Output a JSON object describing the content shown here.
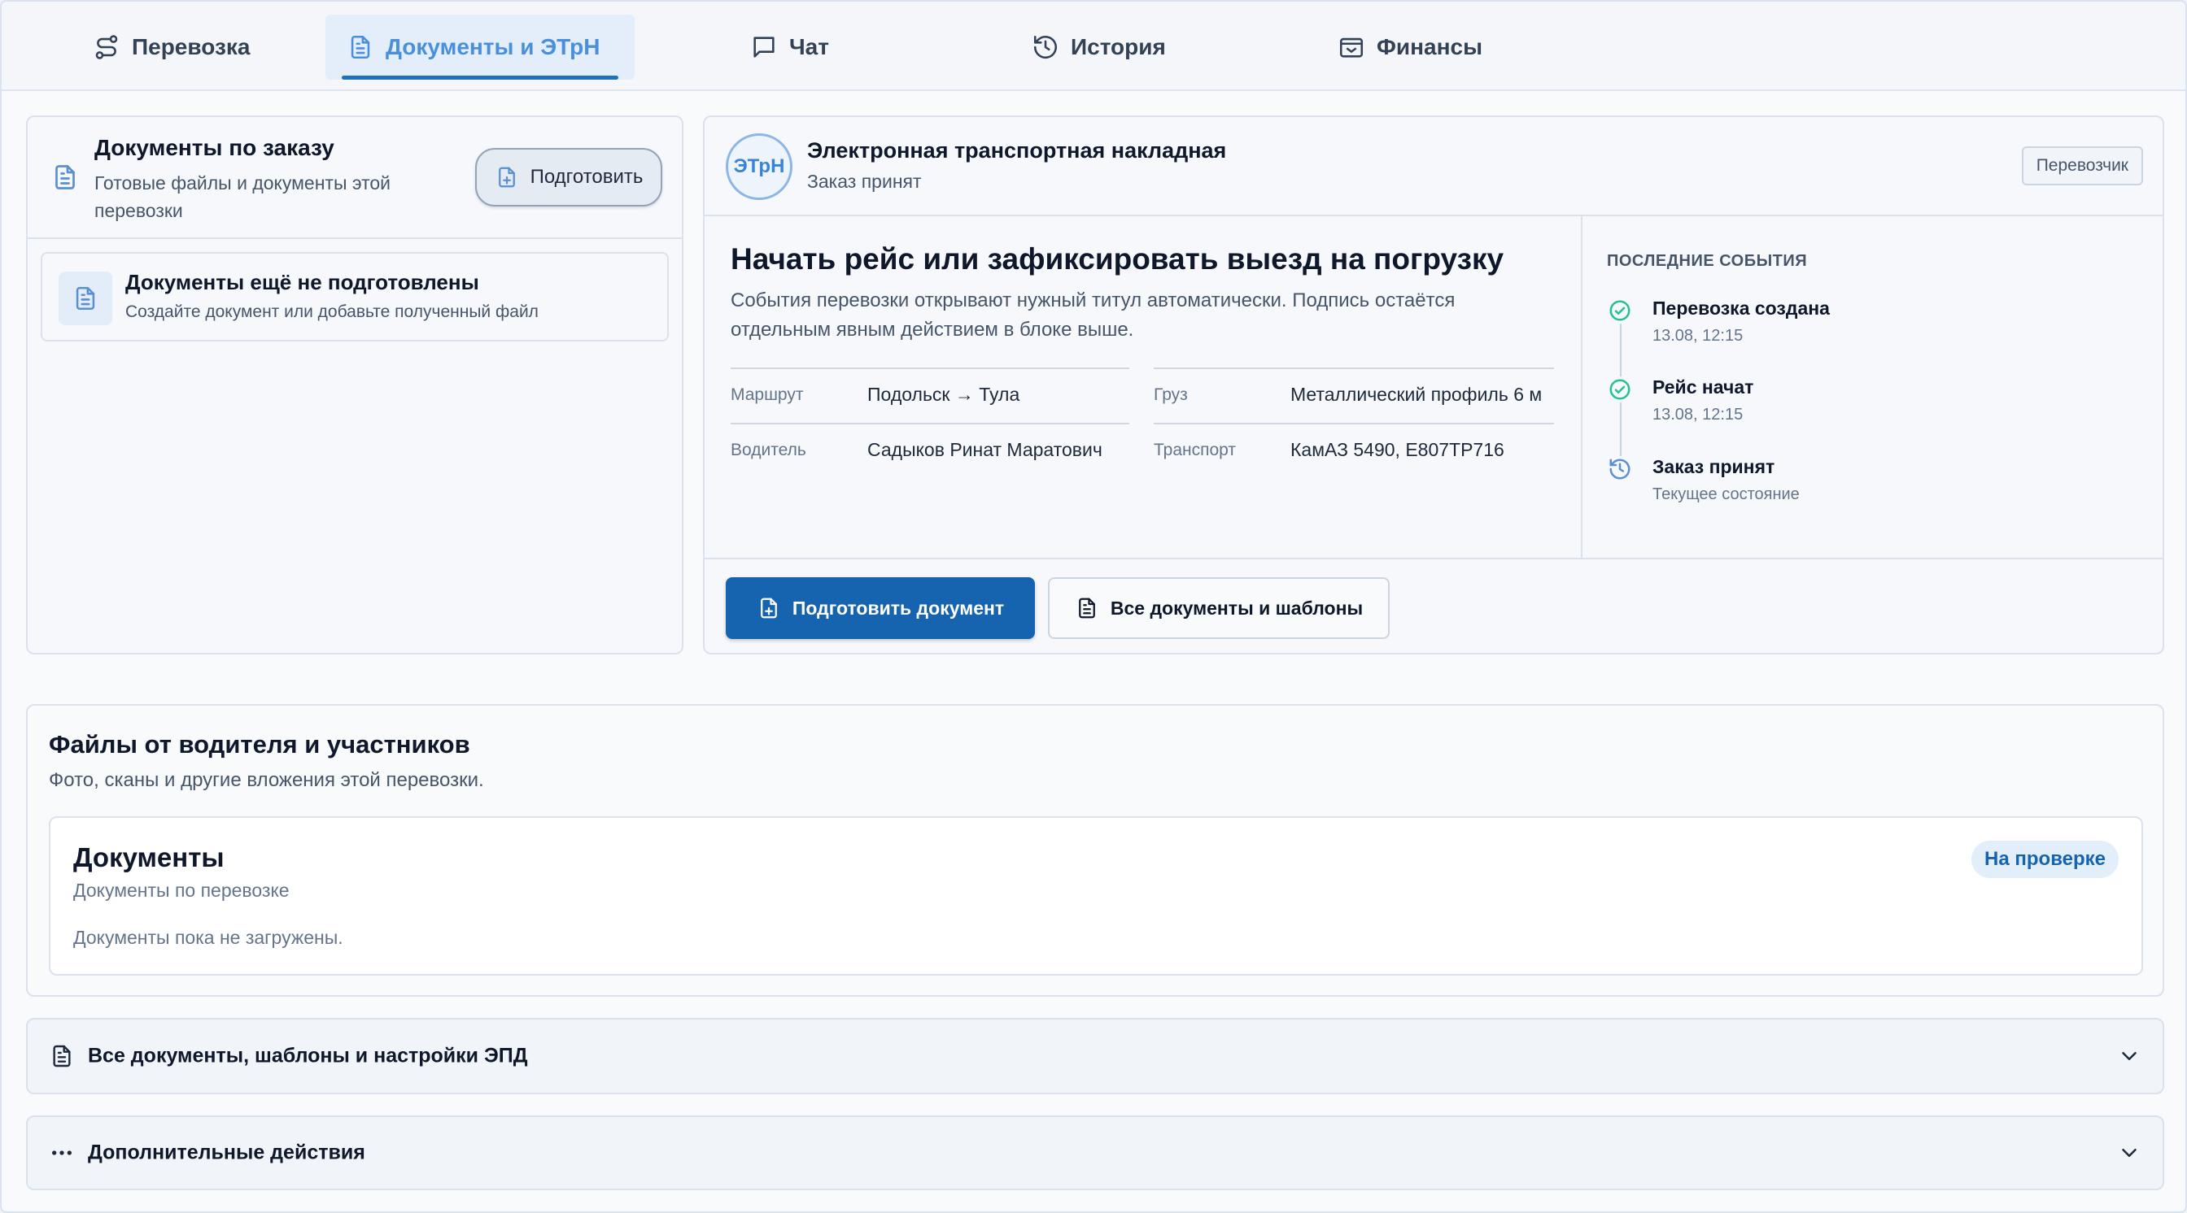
{
  "tabs": [
    {
      "label": "Перевозка",
      "icon": "route-icon"
    },
    {
      "label": "Документы и ЭТрН",
      "icon": "document-icon",
      "active": true
    },
    {
      "label": "Чат",
      "icon": "chat-icon"
    },
    {
      "label": "История",
      "icon": "history-icon"
    },
    {
      "label": "Финансы",
      "icon": "wallet-icon"
    }
  ],
  "order_docs": {
    "title": "Документы по заказу",
    "subtitle": "Готовые файлы и документы этой перевозки",
    "prepare_label": "Подготовить",
    "empty_title": "Документы ещё не подготовлены",
    "empty_subtitle": "Создайте документ или добавьте полученный файл"
  },
  "etrn": {
    "badge": "ЭТрН",
    "title": "Электронная транспортная накладная",
    "status": "Заказ принят",
    "role": "Перевозчик",
    "headline": "Начать рейс или зафиксировать выезд на погрузку",
    "description": "События перевозки открывают нужный титул автоматически. Подпись остаётся отдельным явным действием в блоке выше.",
    "details": {
      "route_label": "Маршрут",
      "route_value": "Подольск → Тула",
      "cargo_label": "Груз",
      "cargo_value": "Металлический профиль 6 м",
      "driver_label": "Водитель",
      "driver_value": "Садыков Ринат Маратович",
      "transport_label": "Транспорт",
      "transport_value": "КамАЗ 5490, Е807ТР716"
    },
    "events_label": "ПОСЛЕДНИЕ СОБЫТИЯ",
    "events": [
      {
        "title": "Перевозка создана",
        "sub": "13.08, 12:15",
        "icon": "check-circle-icon"
      },
      {
        "title": "Рейс начат",
        "sub": "13.08, 12:15",
        "icon": "check-circle-icon"
      },
      {
        "title": "Заказ принят",
        "sub": "Текущее состояние",
        "icon": "history-icon"
      }
    ],
    "primary_button": "Подготовить документ",
    "secondary_button": "Все документы и шаблоны"
  },
  "files": {
    "title": "Файлы от водителя и участников",
    "subtitle": "Фото, сканы и другие вложения этой перевозки.",
    "docs_title": "Документы",
    "docs_subtitle": "Документы по перевозке",
    "docs_status": "На проверке",
    "docs_empty": "Документы пока не загружены."
  },
  "accordions": {
    "all_docs": "Все документы, шаблоны и настройки ЭПД",
    "more_actions": "Дополнительные действия"
  },
  "colors": {
    "accent": "#1663b0",
    "tab_active": "#4a8fdc",
    "success": "#22c38e"
  }
}
